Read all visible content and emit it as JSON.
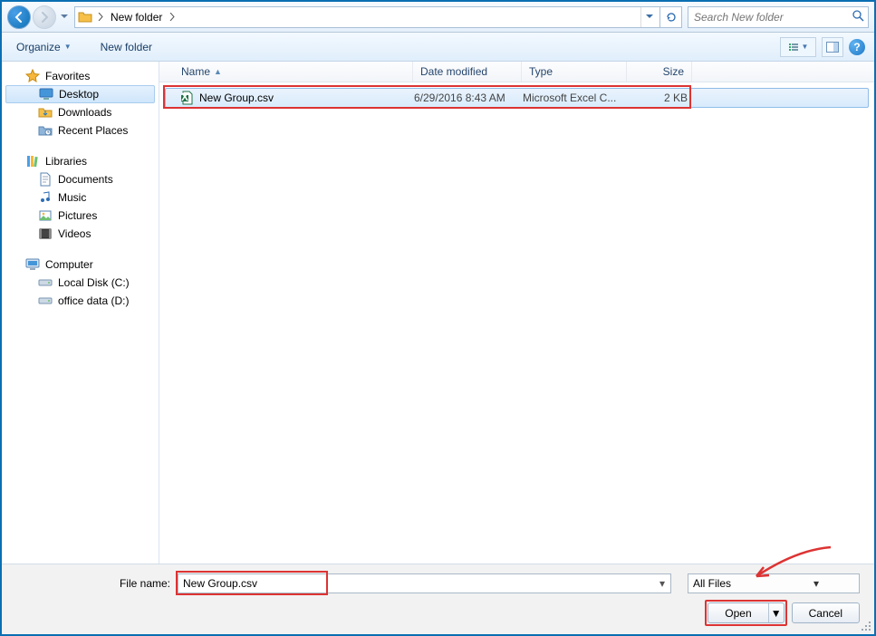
{
  "nav": {
    "crumb_folder": "New folder",
    "search_placeholder": "Search New folder"
  },
  "toolbar": {
    "organize": "Organize",
    "newfolder": "New folder"
  },
  "sidebar": {
    "favorites": "Favorites",
    "desktop": "Desktop",
    "downloads": "Downloads",
    "recent": "Recent Places",
    "libraries": "Libraries",
    "documents": "Documents",
    "music": "Music",
    "pictures": "Pictures",
    "videos": "Videos",
    "computer": "Computer",
    "localdisk": "Local Disk (C:)",
    "officedata": "office data (D:)"
  },
  "columns": {
    "name": "Name",
    "modified": "Date modified",
    "type": "Type",
    "size": "Size"
  },
  "files": [
    {
      "name": "New Group.csv",
      "modified": "6/29/2016 8:43 AM",
      "type": "Microsoft Excel C...",
      "size": "2 KB"
    }
  ],
  "footer": {
    "label": "File name:",
    "value": "New Group.csv",
    "filter": "All Files",
    "open": "Open",
    "cancel": "Cancel"
  }
}
